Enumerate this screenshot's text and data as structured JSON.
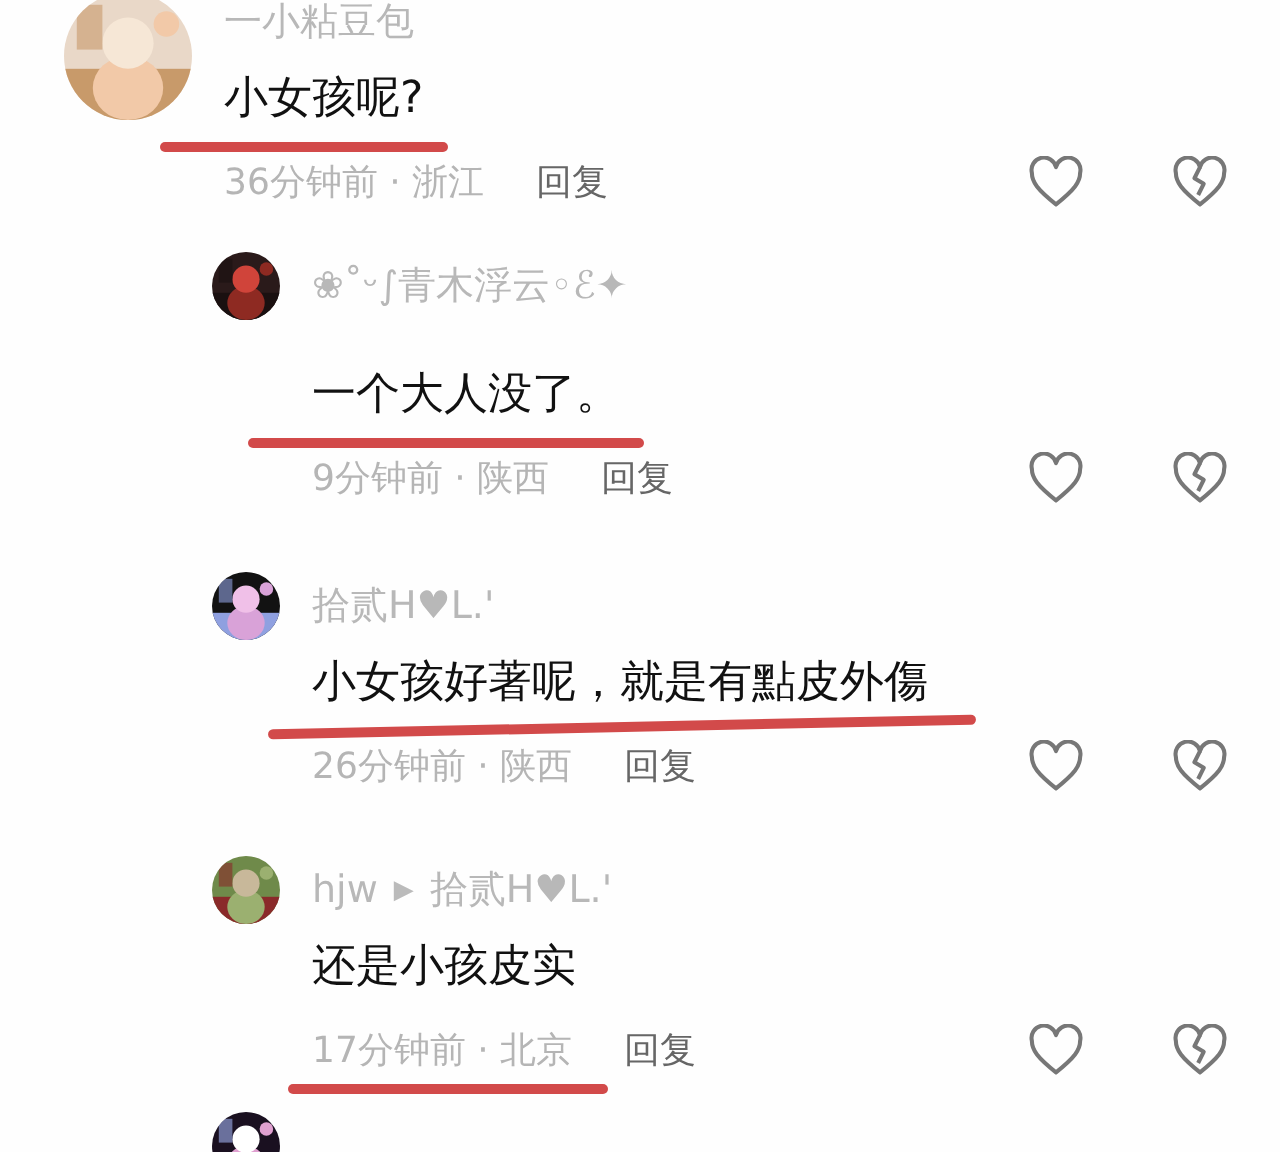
{
  "comments": [
    {
      "kind": "comment",
      "author": "一小粘豆包",
      "text": "小女孩呢?",
      "time": "36分钟前 · 浙江",
      "reply": "回复",
      "text_underlined": true,
      "meta_underlined": false
    },
    {
      "kind": "reply",
      "author": "❀˚ᵕ∫青木浮云◦ℰ✦",
      "text": "一个大人没了。",
      "time": "9分钟前 · 陕西",
      "reply": "回复",
      "text_underlined": true,
      "meta_underlined": false
    },
    {
      "kind": "reply",
      "author": "拾贰H♥L.'",
      "text": "小女孩好著呢，就是有點皮外傷",
      "time": "26分钟前 · 陕西",
      "reply": "回复",
      "text_underlined": true,
      "meta_underlined": false
    },
    {
      "kind": "reply",
      "author": "hjw",
      "arrow": "▶",
      "reply_to": "拾贰H♥L.'",
      "text": "还是小孩皮实",
      "time": "17分钟前 · 北京",
      "reply": "回复",
      "text_underlined": false,
      "meta_underlined": true
    }
  ]
}
